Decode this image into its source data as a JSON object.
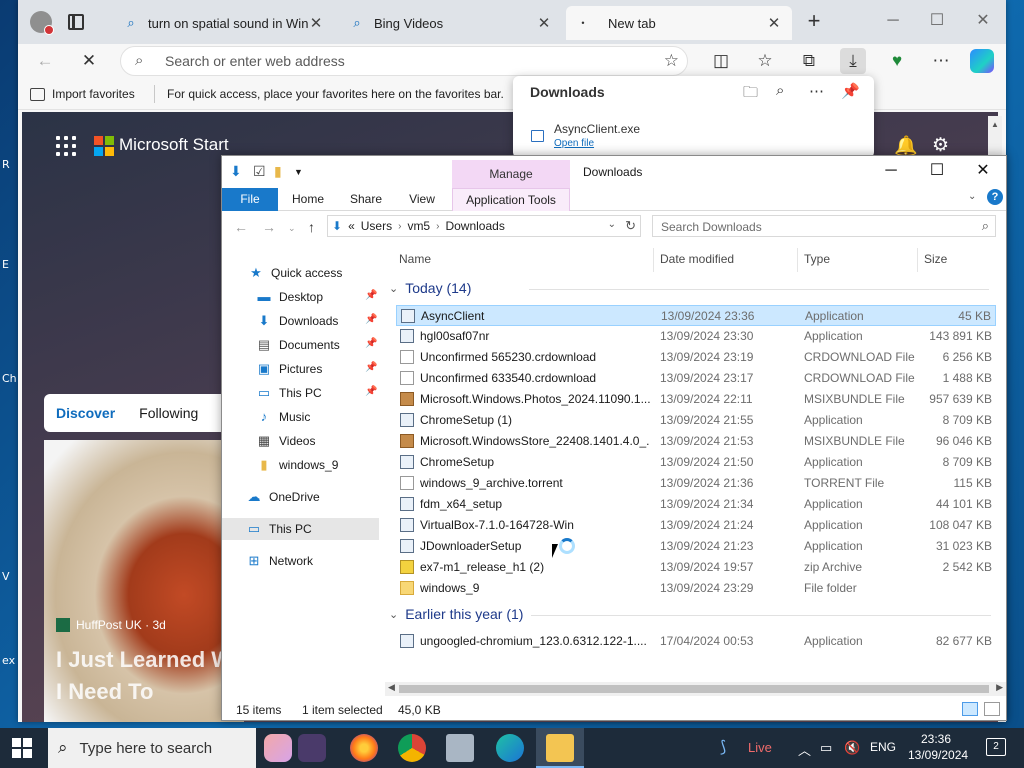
{
  "desktop": {
    "labels": [
      "R",
      "E",
      "Ch",
      "",
      "V",
      "ex"
    ]
  },
  "browser": {
    "tabs": [
      {
        "title": "turn on spatial sound in Windo",
        "icon": "search-icon"
      },
      {
        "title": "Bing Videos",
        "icon": "search-icon"
      },
      {
        "title": "New tab",
        "icon": "loading-icon"
      }
    ],
    "address_placeholder": "Search or enter web address",
    "favorites": {
      "import_label": "Import favorites",
      "hint": "For quick access, place your favorites here on the favorites bar."
    },
    "page": {
      "brand": "Microsoft Start",
      "feed_tabs": [
        "Discover",
        "Following"
      ],
      "card_source": "HuffPost UK · 3d",
      "card_headline_line1": "I Just Learned W",
      "card_headline_line2": "I Need To"
    },
    "downloads_panel": {
      "title": "Downloads",
      "file_name": "AsyncClient.exe",
      "open_label": "Open file"
    }
  },
  "explorer": {
    "title": "Downloads",
    "manage_label": "Manage",
    "ribbon_tabs": [
      "File",
      "Home",
      "Share",
      "View",
      "Application Tools"
    ],
    "path": [
      "«",
      "Users",
      "vm5",
      "Downloads"
    ],
    "search_placeholder": "Search Downloads",
    "nav": [
      {
        "label": "Quick access",
        "icon": "star-icon",
        "pinned": false
      },
      {
        "label": "Desktop",
        "icon": "desktop-icon",
        "pinned": true
      },
      {
        "label": "Downloads",
        "icon": "download-icon",
        "pinned": true
      },
      {
        "label": "Documents",
        "icon": "document-icon",
        "pinned": true
      },
      {
        "label": "Pictures",
        "icon": "picture-icon",
        "pinned": true
      },
      {
        "label": "This PC",
        "icon": "pc-icon",
        "pinned": true
      },
      {
        "label": "Music",
        "icon": "music-icon",
        "pinned": false
      },
      {
        "label": "Videos",
        "icon": "video-icon",
        "pinned": false
      },
      {
        "label": "windows_9",
        "icon": "folder-icon",
        "pinned": false
      },
      {
        "label": "OneDrive",
        "icon": "cloud-icon",
        "pinned": false
      },
      {
        "label": "This PC",
        "icon": "pc-icon",
        "pinned": false
      },
      {
        "label": "Network",
        "icon": "network-icon",
        "pinned": false
      }
    ],
    "columns": [
      "Name",
      "Date modified",
      "Type",
      "Size"
    ],
    "group_today": "Today (14)",
    "group_earlier": "Earlier this year (1)",
    "files_today": [
      {
        "name": "AsyncClient",
        "date": "13/09/2024 23:36",
        "type": "Application",
        "size": "45 KB",
        "icon": "app"
      },
      {
        "name": "hgl00saf07nr",
        "date": "13/09/2024 23:30",
        "type": "Application",
        "size": "143 891 KB",
        "icon": "app"
      },
      {
        "name": "Unconfirmed 565230.crdownload",
        "date": "13/09/2024 23:19",
        "type": "CRDOWNLOAD File",
        "size": "6 256 KB",
        "icon": "doc"
      },
      {
        "name": "Unconfirmed 633540.crdownload",
        "date": "13/09/2024 23:17",
        "type": "CRDOWNLOAD File",
        "size": "1 488 KB",
        "icon": "doc"
      },
      {
        "name": "Microsoft.Windows.Photos_2024.11090.1...",
        "date": "13/09/2024 22:11",
        "type": "MSIXBUNDLE File",
        "size": "957 639 KB",
        "icon": "pkg"
      },
      {
        "name": "ChromeSetup (1)",
        "date": "13/09/2024 21:55",
        "type": "Application",
        "size": "8 709 KB",
        "icon": "app"
      },
      {
        "name": "Microsoft.WindowsStore_22408.1401.4.0_...",
        "date": "13/09/2024 21:53",
        "type": "MSIXBUNDLE File",
        "size": "96 046 KB",
        "icon": "pkg"
      },
      {
        "name": "ChromeSetup",
        "date": "13/09/2024 21:50",
        "type": "Application",
        "size": "8 709 KB",
        "icon": "app"
      },
      {
        "name": "windows_9_archive.torrent",
        "date": "13/09/2024 21:36",
        "type": "TORRENT File",
        "size": "115 KB",
        "icon": "doc"
      },
      {
        "name": "fdm_x64_setup",
        "date": "13/09/2024 21:34",
        "type": "Application",
        "size": "44 101 KB",
        "icon": "app"
      },
      {
        "name": "VirtualBox-7.1.0-164728-Win",
        "date": "13/09/2024 21:24",
        "type": "Application",
        "size": "108 047 KB",
        "icon": "app"
      },
      {
        "name": "JDownloaderSetup",
        "date": "13/09/2024 21:23",
        "type": "Application",
        "size": "31 023 KB",
        "icon": "app"
      },
      {
        "name": "ex7-m1_release_h1 (2)",
        "date": "13/09/2024 19:57",
        "type": "zip Archive",
        "size": "2 542 KB",
        "icon": "zip"
      },
      {
        "name": "windows_9",
        "date": "13/09/2024 23:29",
        "type": "File folder",
        "size": "",
        "icon": "folder"
      }
    ],
    "files_earlier": [
      {
        "name": "ungoogled-chromium_123.0.6312.122-1....",
        "date": "17/04/2024 00:53",
        "type": "Application",
        "size": "82 677 KB",
        "icon": "app"
      }
    ],
    "status": {
      "items": "15 items",
      "selected": "1 item selected",
      "size": "45,0 KB"
    }
  },
  "taskbar": {
    "search_placeholder": "Type here to search",
    "live": "Live",
    "lang": "ENG",
    "time": "23:36",
    "date": "13/09/2024",
    "notifications": "2"
  }
}
